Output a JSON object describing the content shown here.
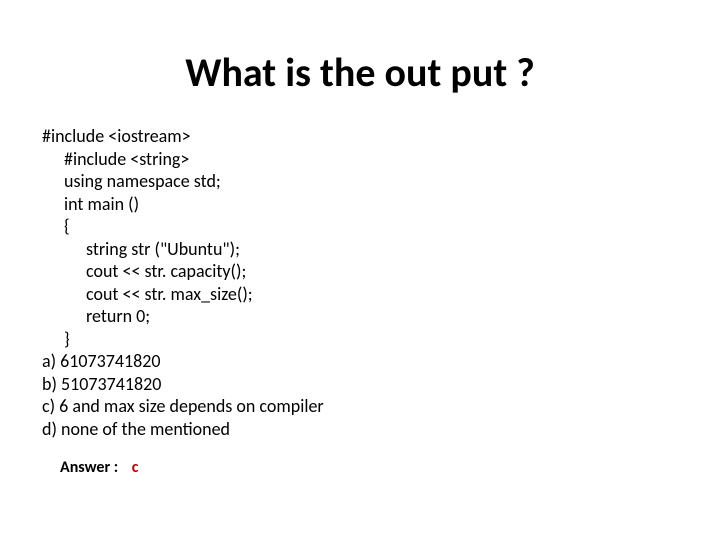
{
  "title": "What is the out put ?",
  "code": {
    "l1": "#include <iostream>",
    "l2": "#include <string>",
    "l3": "using namespace std;",
    "l4": "int main ()",
    "l5": "{",
    "l6": "string str (\"Ubuntu\");",
    "l7": "cout << str. capacity();",
    "l8": "cout << str. max_size();",
    "l9": "return 0;",
    "l10": "}"
  },
  "options": {
    "a": "a) 61073741820",
    "b": "b) 51073741820",
    "c": "c) 6 and max size depends on compiler",
    "d": "d) none of the mentioned"
  },
  "answer": {
    "label": "Answer :",
    "value": "c"
  }
}
